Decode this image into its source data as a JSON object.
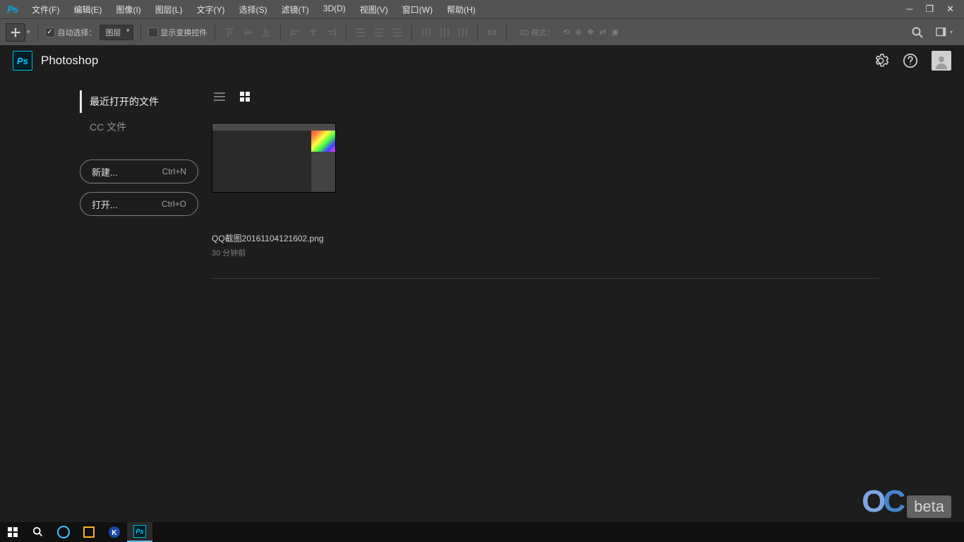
{
  "app": {
    "logo": "Ps",
    "title": "Photoshop"
  },
  "menu": {
    "file": "文件(F)",
    "edit": "编辑(E)",
    "image": "图像(I)",
    "layer": "图层(L)",
    "type": "文字(Y)",
    "select": "选择(S)",
    "filter": "滤镜(T)",
    "threeD": "3D(D)",
    "view": "视图(V)",
    "window": "窗口(W)",
    "help": "帮助(H)"
  },
  "options": {
    "auto_select_label": "自动选择：",
    "auto_select_target": "图层",
    "show_transform": "显示变换控件",
    "mode_3d": "3D 模式："
  },
  "home": {
    "tabs": {
      "recent": "最近打开的文件",
      "cc": "CC 文件"
    },
    "new_btn": "新建...",
    "new_shortcut": "Ctrl+N",
    "open_btn": "打开...",
    "open_shortcut": "Ctrl+O"
  },
  "recent": [
    {
      "name": "QQ截图20161104121602.png",
      "time": "30 分钟前"
    }
  ],
  "watermark": {
    "o": "O",
    "c": "C",
    "beta": "beta"
  }
}
